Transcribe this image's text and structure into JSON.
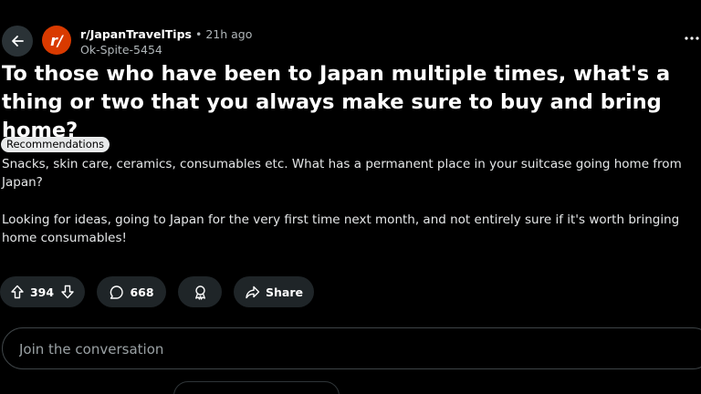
{
  "header": {
    "subreddit": "r/JapanTravelTips",
    "separator": "•",
    "time_ago": "21h ago",
    "username": "Ok-Spite-5454",
    "avatar_text": "r/",
    "avatar_color": "#d93a00"
  },
  "post": {
    "title": "To those who have been to Japan multiple times, what's a thing or two that you always make sure to buy and bring home?",
    "flair": "Recommendations",
    "paragraphs": [
      "Snacks, skin care, ceramics, consumables etc. What has a permanent place in your suitcase going home from Japan?",
      "Looking for ideas, going to Japan for the very first time next month, and not entirely sure if it's worth bringing home consumables!"
    ]
  },
  "actions": {
    "upvote_count": "394",
    "comment_count": "668",
    "share_label": "Share"
  },
  "comment_box": {
    "placeholder": "Join the conversation"
  },
  "icons": [
    "back-arrow-icon",
    "more-dots-icon",
    "upvote-icon",
    "downvote-icon",
    "comment-icon",
    "award-icon",
    "share-icon"
  ],
  "colors": {
    "background": "#000000",
    "pill": "#1f2528",
    "brand": "#d93a00",
    "meta_text": "#b0b6b9"
  }
}
